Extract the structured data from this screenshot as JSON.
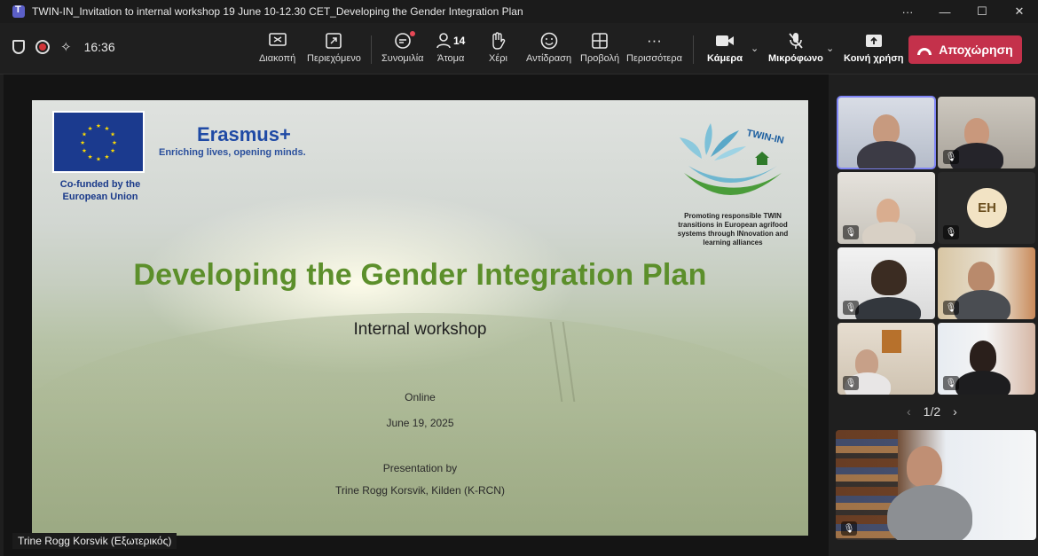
{
  "window": {
    "title": "TWIN-IN_Invitation to internal workshop 19 June 10-12.30 CET_Developing the Gender Integration Plan",
    "more": "···",
    "minimize": "—",
    "maximize": "☐",
    "close": "✕"
  },
  "toolbar": {
    "time": "16:36",
    "buttons": {
      "stop": "Διακοπή",
      "content": "Περιεχόμενο",
      "chat": "Συνομιλία",
      "people": "Άτομα",
      "people_count": "14",
      "raise": "Χέρι",
      "react": "Αντίδραση",
      "view": "Προβολή",
      "more": "Περισσότερα",
      "camera": "Κάμερα",
      "mic": "Μικρόφωνο",
      "share": "Κοινή χρήση"
    },
    "leave_label": "Αποχώρηση"
  },
  "slide": {
    "cofund": "Co-funded by the European Union",
    "erasmus": "Erasmus+",
    "erasmus_sub": "Enriching lives, opening minds.",
    "twin_logo_text": "TWIN-IN",
    "twin_tagline": "Promoting responsible TWIN transitions in European agrifood systems through INnovation and learning alliances",
    "title": "Developing the Gender Integration Plan",
    "subtitle": "Internal workshop",
    "online": "Online",
    "date": "June 19, 2025",
    "presented_by": "Presentation by",
    "presenter": "Trine Rogg Korsvik, Kilden (K-RCN)"
  },
  "stage": {
    "speaker_label": "Trine Rogg Korsvik (Εξωτερικός)"
  },
  "gallery": {
    "initials": "EH",
    "page": "1/2"
  },
  "colors": {
    "leave": "#c4314b",
    "accent": "#7f85f5",
    "slide_title": "#5c8f2b",
    "erasmus_blue": "#1f4aa5"
  }
}
